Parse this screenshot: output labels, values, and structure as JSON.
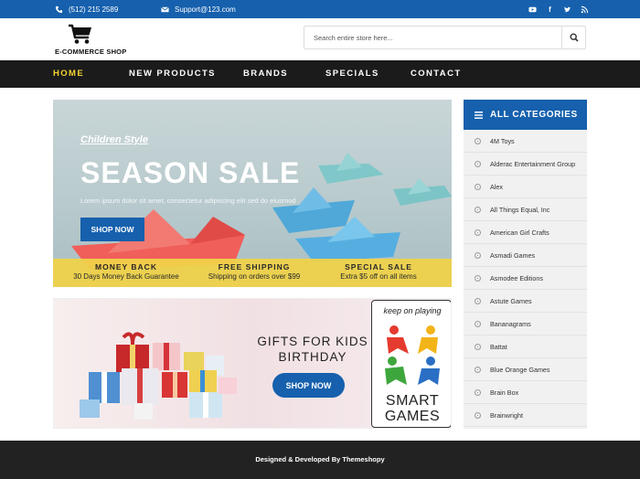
{
  "topbar": {
    "phone": "(512) 215 2589",
    "email": "Support@123.com",
    "social": [
      "youtube-icon",
      "facebook-icon",
      "twitter-icon",
      "rss-icon"
    ]
  },
  "header": {
    "logo_text": "E-COMMERCE SHOP",
    "search_placeholder": "Search entire store here..."
  },
  "nav": {
    "items": [
      "HOME",
      "NEW PRODUCTS",
      "BRANDS",
      "SPECIALS",
      "CONTACT"
    ],
    "active": "HOME"
  },
  "banner1": {
    "style": "Children Style",
    "title": "SEASON SALE",
    "text": "Lorem ipsum dolor sit amet, consectetur adipiscing elit sed do eiusmod",
    "button": "SHOP NOW",
    "features": [
      {
        "title": "MONEY BACK",
        "sub": "30 Days Money Back Guarantee"
      },
      {
        "title": "FREE SHIPPING",
        "sub": "Shipping on orders over $99"
      },
      {
        "title": "SPECIAL SALE",
        "sub": "Extra $5 off on all items"
      }
    ]
  },
  "banner2": {
    "title_line1": "GIFTS FOR KIDS",
    "title_line2": "BIRTHDAY",
    "button": "SHOP NOW",
    "logo_tagline": "keep on playing",
    "logo_line1": "SMART",
    "logo_line2": "GAMES"
  },
  "sidebar": {
    "title": "ALL CATEGORIES",
    "items": [
      "4M Toys",
      "Alderac Entertainment Group",
      "Alex",
      "All Things Equal, Inc",
      "American Girl Crafts",
      "Asmadi Games",
      "Asmodee Editions",
      "Astute Games",
      "Bananagrams",
      "Battat",
      "Blue Orange Games",
      "Brain Box",
      "Brainwright"
    ]
  },
  "footer": {
    "text": "Designed & Developed By Themeshopy"
  },
  "colors": {
    "brand_blue": "#1660ad",
    "nav_bg": "#1b1b1b",
    "active_nav": "#f5d432",
    "strip_yellow": "#f0d24a"
  }
}
